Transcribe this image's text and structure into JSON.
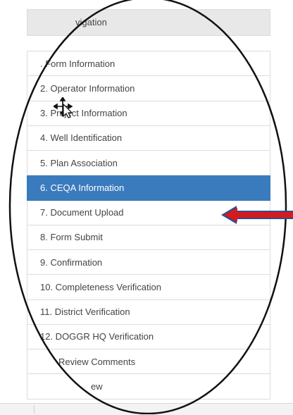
{
  "navigation": {
    "header_title": "vigation",
    "items": [
      {
        "label": ". Form Information",
        "active": false
      },
      {
        "label": "2. Operator Information",
        "active": false
      },
      {
        "label": "3. Project Information",
        "active": false
      },
      {
        "label": "4. Well Identification",
        "active": false
      },
      {
        "label": "5. Plan Association",
        "active": false
      },
      {
        "label": "6. CEQA Information",
        "active": true
      },
      {
        "label": "7. Document Upload",
        "active": false
      },
      {
        "label": "8. Form Submit",
        "active": false
      },
      {
        "label": "9. Confirmation",
        "active": false
      },
      {
        "label": "10. Completeness Verification",
        "active": false
      },
      {
        "label": "11. District Verification",
        "active": false
      },
      {
        "label": "12. DOGGR HQ Verification",
        "active": false
      },
      {
        "label": "Review Comments",
        "active": false
      },
      {
        "label": "ew",
        "active": false
      }
    ]
  },
  "colors": {
    "active_item": "#3a7bbd",
    "annotation_arrow": "#d71920",
    "annotation_arrow_outline": "#2f4e8a",
    "oval_outline": "#111111"
  }
}
